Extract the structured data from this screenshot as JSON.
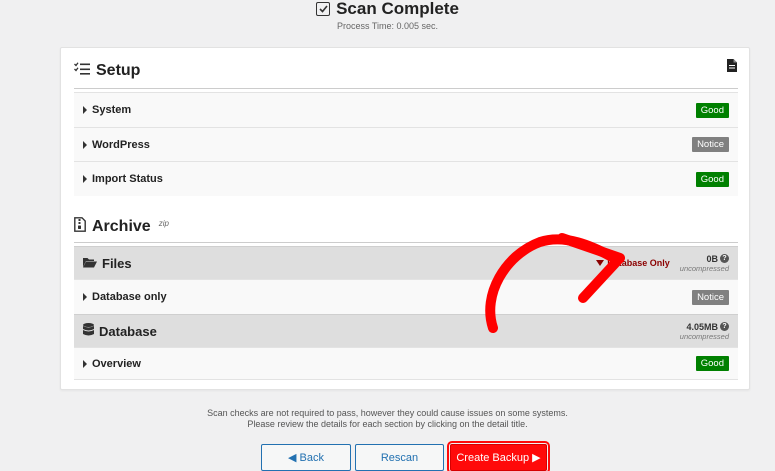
{
  "header": {
    "title": "Scan Complete",
    "subtitle": "Process Time: 0.005 sec."
  },
  "setup": {
    "title": "Setup",
    "rows": [
      {
        "label": "System",
        "status": "Good"
      },
      {
        "label": "WordPress",
        "status": "Notice"
      },
      {
        "label": "Import Status",
        "status": "Good"
      }
    ]
  },
  "archive": {
    "title": "Archive",
    "sup": "zip",
    "files": {
      "label": "Files",
      "filter": "Database Only",
      "size": "0B",
      "note": "uncompressed"
    },
    "database_only": {
      "label": "Database only",
      "status": "Notice"
    },
    "database": {
      "label": "Database",
      "size": "4.05MB",
      "note": "uncompressed"
    },
    "overview": {
      "label": "Overview",
      "status": "Good"
    }
  },
  "footer": {
    "line1": "Scan checks are not required to pass, however they could cause issues on some systems.",
    "line2": "Please review the details for each section by clicking on the detail title."
  },
  "buttons": {
    "back": "◀ Back",
    "rescan": "Rescan",
    "create": "Create Backup ▶"
  },
  "colors": {
    "good": "#008000",
    "notice": "#808080",
    "annotation_arrow": "#ff0000",
    "primary": "#2271b1"
  }
}
